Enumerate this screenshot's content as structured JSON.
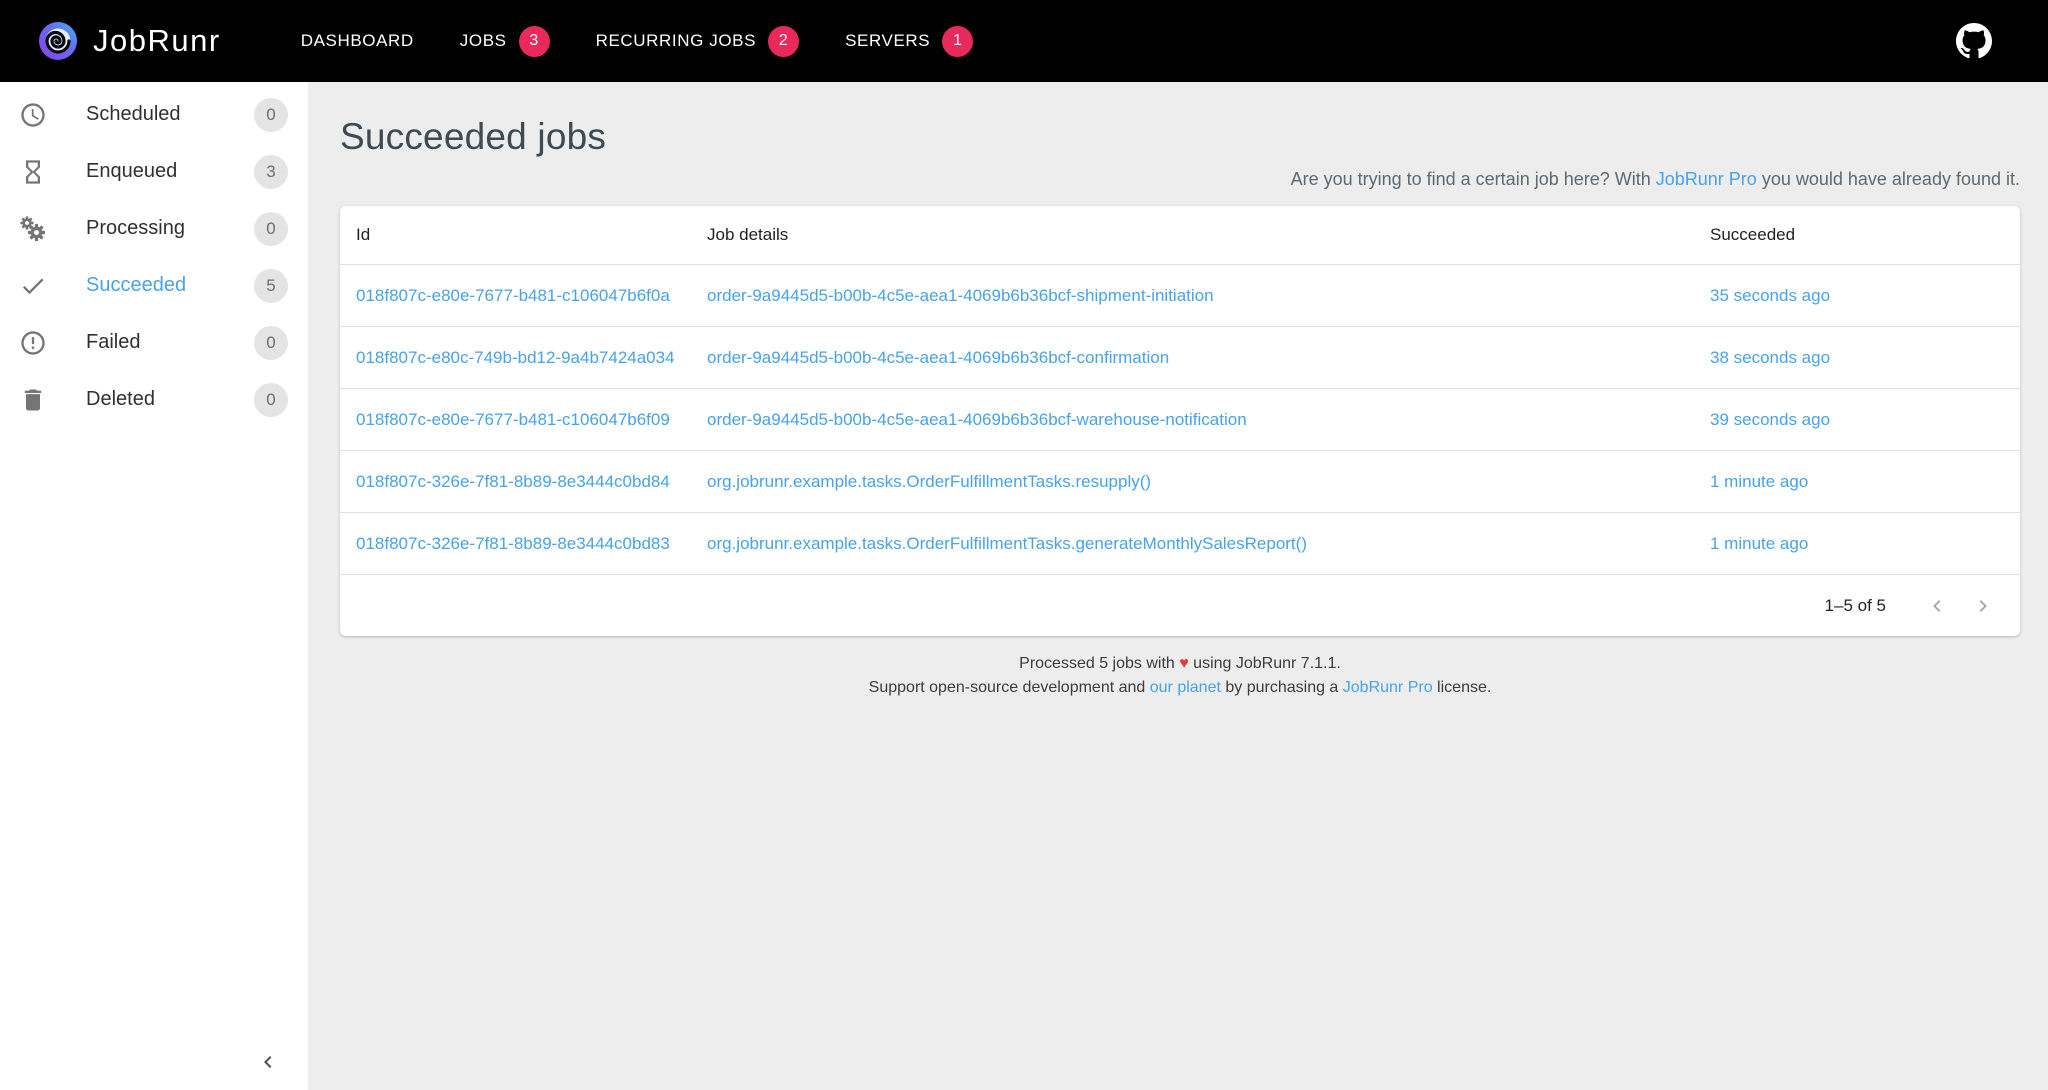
{
  "navbar": {
    "brand": "JobRunr",
    "items": [
      {
        "label": "DASHBOARD",
        "badge": null
      },
      {
        "label": "JOBS",
        "badge": "3"
      },
      {
        "label": "RECURRING JOBS",
        "badge": "2"
      },
      {
        "label": "SERVERS",
        "badge": "1"
      }
    ],
    "github_icon": "github-octocat"
  },
  "sidebar": {
    "items": [
      {
        "label": "Scheduled",
        "count": "0",
        "icon": "clock-icon",
        "active": false
      },
      {
        "label": "Enqueued",
        "count": "3",
        "icon": "hourglass-icon",
        "active": false
      },
      {
        "label": "Processing",
        "count": "0",
        "icon": "gears-icon",
        "active": false
      },
      {
        "label": "Succeeded",
        "count": "5",
        "icon": "check-icon",
        "active": true
      },
      {
        "label": "Failed",
        "count": "0",
        "icon": "error-circle-icon",
        "active": false
      },
      {
        "label": "Deleted",
        "count": "0",
        "icon": "trash-icon",
        "active": false
      }
    ],
    "collapse_icon": "chevron-left"
  },
  "main": {
    "title": "Succeeded jobs",
    "hint": {
      "pre": "Are you trying to find a certain job here? With ",
      "link": "JobRunr Pro",
      "post": " you would have already found it."
    },
    "table": {
      "columns": [
        "Id",
        "Job details",
        "Succeeded"
      ],
      "rows": [
        {
          "id": "018f807c-e80e-7677-b481-c106047b6f0a",
          "details": "order-9a9445d5-b00b-4c5e-aea1-4069b6b36bcf-shipment-initiation",
          "succeeded": "35 seconds ago"
        },
        {
          "id": "018f807c-e80c-749b-bd12-9a4b7424a034",
          "details": "order-9a9445d5-b00b-4c5e-aea1-4069b6b36bcf-confirmation",
          "succeeded": "38 seconds ago"
        },
        {
          "id": "018f807c-e80e-7677-b481-c106047b6f09",
          "details": "order-9a9445d5-b00b-4c5e-aea1-4069b6b36bcf-warehouse-notification",
          "succeeded": "39 seconds ago"
        },
        {
          "id": "018f807c-326e-7f81-8b89-8e3444c0bd84",
          "details": "org.jobrunr.example.tasks.OrderFulfillmentTasks.resupply()",
          "succeeded": "1 minute ago"
        },
        {
          "id": "018f807c-326e-7f81-8b89-8e3444c0bd83",
          "details": "org.jobrunr.example.tasks.OrderFulfillmentTasks.generateMonthlySalesReport()",
          "succeeded": "1 minute ago"
        }
      ],
      "pagination": {
        "range": "1–5 of 5"
      }
    }
  },
  "footer": {
    "line1_pre": "Processed 5 jobs with ",
    "heart": "♥",
    "line1_post": " using JobRunr 7.1.1.",
    "line2_pre": "Support open-source development and ",
    "line2_link1": "our planet",
    "line2_mid": " by purchasing a ",
    "line2_link2": "JobRunr Pro",
    "line2_post": " license."
  },
  "colors": {
    "navbar_bg": "#000000",
    "page_bg": "#ededed",
    "accent_red": "#e8295b",
    "link_blue": "#47a2e9",
    "title_color": "#3d4b54",
    "badge_bg": "#e4e4e4",
    "heart_red": "#e53935"
  }
}
